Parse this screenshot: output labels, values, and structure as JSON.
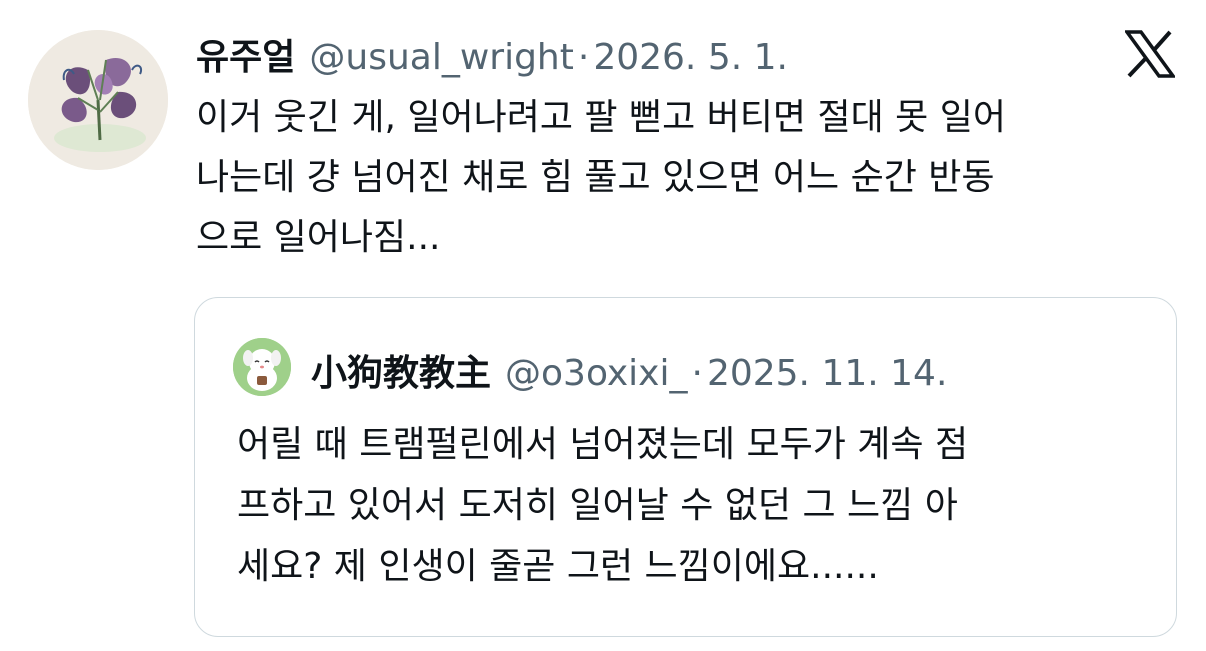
{
  "tweet": {
    "display_name": "유주얼",
    "handle": "@usual_wright",
    "separator": "·",
    "date": "2026. 5. 1.",
    "avatar_icon": "plant-illustration-avatar",
    "brand_icon": "x-logo-icon",
    "text_lines": [
      "이거 웃긴 게, 일어나려고 팔 뻗고 버티면 절대 못 일어",
      "나는데 걍 넘어진 채로 힘 풀고 있으면 어느 순간 반동",
      "으로 일어나짐..."
    ]
  },
  "quote": {
    "display_name": "小狗教教主",
    "handle": "@o3oxixi_",
    "separator": "·",
    "date": "2025. 11. 14.",
    "avatar_icon": "cartoon-dog-avatar",
    "text_lines": [
      "어릴 때 트램펄린에서 넘어졌는데 모두가 계속 점",
      "프하고 있어서 도저히 일어날 수 없던 그 느낌 아",
      "세요? 제 인생이 줄곧 그런 느낌이에요......"
    ]
  },
  "colors": {
    "text_primary": "#0f1419",
    "text_secondary": "#536471",
    "border": "#cfd9de"
  }
}
